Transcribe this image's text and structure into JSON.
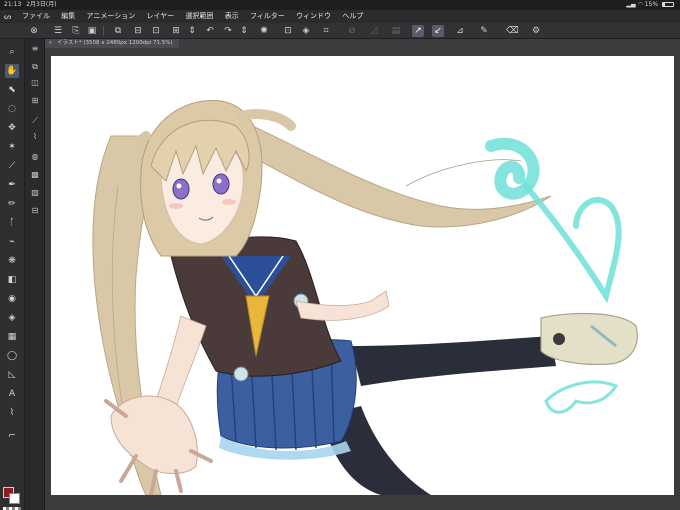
{
  "status_bar": {
    "time": "21:13",
    "date": "2月3日(月)",
    "battery": "15%"
  },
  "menu": {
    "items": [
      "ファイル",
      "編集",
      "アニメーション",
      "レイヤー",
      "選択範囲",
      "表示",
      "フィルター",
      "ウィンドウ",
      "ヘルプ"
    ]
  },
  "document": {
    "tab_title": "イラスト* (3508 x 2480px 1200dpi 71.5%)"
  },
  "colors": {
    "main_color": "#8a1b1e",
    "sub_color": "#ffffff"
  },
  "icons": {
    "app_logo": "app-logo-icon",
    "wifi": "wifi-icon",
    "battery": "battery-icon"
  }
}
